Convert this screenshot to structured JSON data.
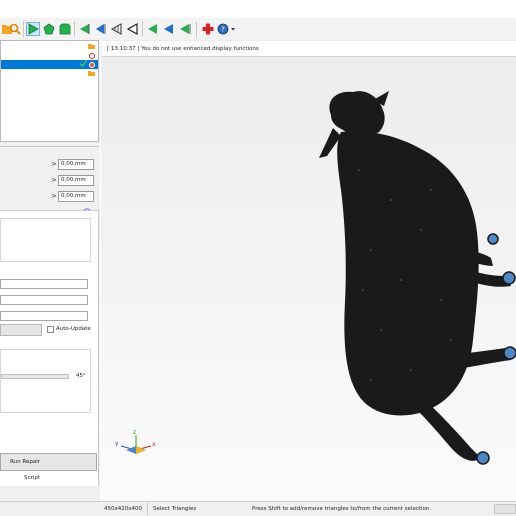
{
  "log": {
    "message": "[ 13:10:37 ] You do not use enhanced display functions"
  },
  "transform": {
    "rows": [
      {
        "value": "0.00 mm"
      },
      {
        "value": "0.00 mm"
      },
      {
        "value": "0.00 mm"
      }
    ]
  },
  "selection_panel": {
    "auto_update_label": "Auto-Update",
    "angle_value": "45°"
  },
  "buttons": {
    "run_repair_script_label": "Run Repair Script"
  },
  "status": {
    "dimensions": "450x420x400",
    "mode": "Select Triangles",
    "hint": "Press Shift to add/remove triangles to/from the current selection."
  },
  "axes": {
    "x_label": "x",
    "y_label": "y",
    "z_label": "z"
  },
  "colors": {
    "selection": "#0078d7",
    "toolbar_green": "#22b14c",
    "toolbar_blue": "#1f6fd0",
    "model": "#1a1a1a",
    "model_highlight": "#4a88c8",
    "add_red": "#e02020"
  },
  "icons": [
    "open-folder-icon",
    "search-icon",
    "select-triangles-icon",
    "select-shell-icon",
    "select-surface-icon",
    "select-left-icon",
    "select-right-icon",
    "wireframe-icon",
    "outline-icon",
    "navigate-left-icon",
    "navigate-back-icon",
    "navigate-forward-icon",
    "add-part-icon",
    "help-icon"
  ]
}
